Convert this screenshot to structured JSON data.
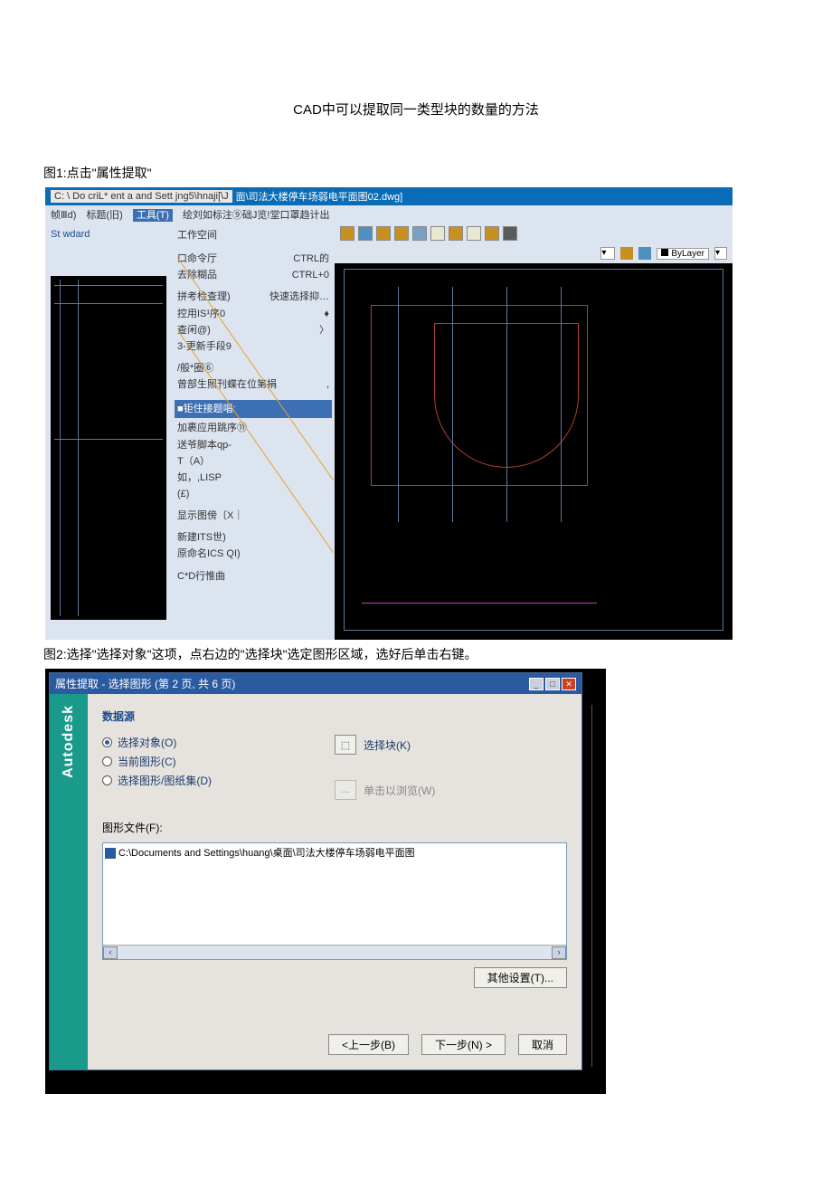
{
  "doc": {
    "title": "CAD中可以提取同一类型块的数量的方法",
    "caption1": "图1:点击\"属性提取\"",
    "caption2": "图2:选择\"选择对象\"这项，点右边的\"选择块\"选定图形区域，选好后单击右键。"
  },
  "fig1": {
    "titlebar_path": "C: \\ Do criL* ent a and Sett jng5\\hnaji[\\J",
    "titlebar_file": "面\\司法大楼停车场弱电平面图02.dwg]",
    "menubar": {
      "m1": "帧Ⅲd)",
      "m2": "标题(旧)",
      "m3": "工具(T)",
      "m4": "绘刘如标注⑨础J览!堂口罩趋计出"
    },
    "left_label": "St wdard",
    "menu": {
      "workspace": "工作空间",
      "cmd1": "口命令厅",
      "cmd1r": "CTRL的",
      "cmd2": "去除糊品",
      "cmd2r": "CTRL+0",
      "spell": "拼考检查理)",
      "spellr": "快速选择抑…",
      "ctrl": "控用IS¹序0",
      "find": "查闲@)",
      "upd": "3-更新手段9",
      "gen": "/般*圈⑥",
      "zeng": "曾部生照刊蝶在位第捐",
      "hl": "■钜住接题唱:",
      "app": "加裹应用跳序⑪",
      "script": "送爷脚本qp-",
      "ta": "T（A）",
      "lisp": "如，,LISP",
      "f": "(£)",
      "disp": "显示图傍〔X｜",
      "its": "新建ITS世)",
      "ics": "原命名ICS QI)",
      "cd": "C*D行惟曲"
    },
    "bylayer": "ByLayer"
  },
  "fig2": {
    "dialog_title": "属性提取 - 选择图形 (第 2 页, 共 6 页)",
    "sidebar": "Autodesk",
    "section_data": "数据源",
    "opt_select_obj": "选择对象(O)",
    "opt_current": "当前图形(C)",
    "opt_sheets": "选择图形/图纸集(D)",
    "select_block": "选择块(K)",
    "browse": "单击以浏览(W)",
    "files_label": "图形文件(F):",
    "file_path": "C:\\Documents and Settings\\huang\\桌面\\司法大楼停车场弱电平面图",
    "other_settings": "其他设置(T)...",
    "prev": "<上一步(B)",
    "next": "下一步(N) >",
    "cancel": "取消"
  }
}
